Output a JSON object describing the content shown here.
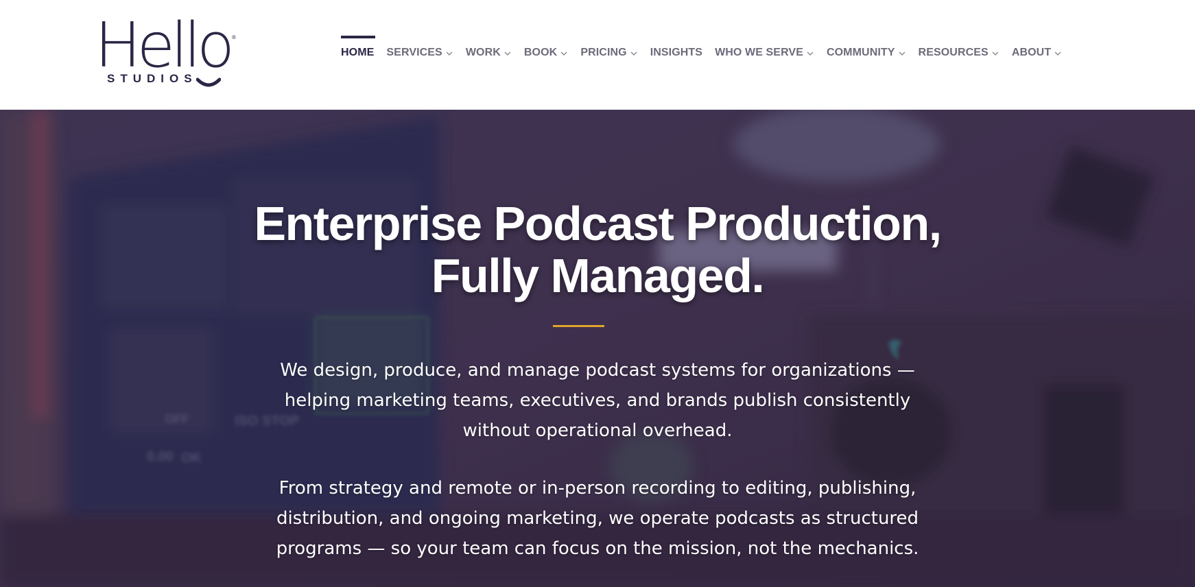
{
  "brand": {
    "wordmark": "Hello",
    "registered": "®",
    "tagline": "STUDIOS",
    "color": "#2a2645"
  },
  "nav": {
    "items": [
      {
        "label": "HOME",
        "active": true,
        "has_dropdown": false
      },
      {
        "label": "SERVICES",
        "active": false,
        "has_dropdown": true
      },
      {
        "label": "WORK",
        "active": false,
        "has_dropdown": true
      },
      {
        "label": "BOOK",
        "active": false,
        "has_dropdown": true
      },
      {
        "label": "PRICING",
        "active": false,
        "has_dropdown": true
      },
      {
        "label": "INSIGHTS",
        "active": false,
        "has_dropdown": false
      },
      {
        "label": "WHO WE SERVE",
        "active": false,
        "has_dropdown": true
      },
      {
        "label": "COMMUNITY",
        "active": false,
        "has_dropdown": true
      },
      {
        "label": "RESOURCES",
        "active": false,
        "has_dropdown": true
      },
      {
        "label": "ABOUT",
        "active": false,
        "has_dropdown": true
      }
    ],
    "dropdown_icon": "chevron-down-icon"
  },
  "hero": {
    "title_line1": "Enterprise Podcast Production,",
    "title_line2": "Fully Managed.",
    "paragraph1": "We design, produce, and manage podcast systems for organizations — helping marketing teams, executives, and brands publish consistently without operational overhead.",
    "paragraph2": "From strategy and remote or in-person recording to editing, publishing, distribution, and ongoing marketing, we operate podcasts as structured programs — so your team can focus on the mission, not the mechanics.",
    "accent_color": "#e0a52b",
    "background_description": "blurred podcast studio with monitors, camera and light"
  },
  "background_text": {
    "monitor_label_1": "OFF",
    "monitor_label_2": "ISO STOP",
    "monitor_label_3": "0.00",
    "monitor_label_4": "OK"
  }
}
